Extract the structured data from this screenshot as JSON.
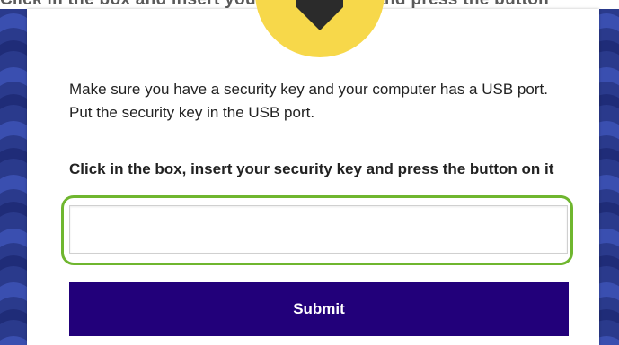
{
  "header": {
    "caption": "Click in the box and insert your security key and press the button"
  },
  "instructions": {
    "text": "Make sure you have a security key and your computer has a USB port. Put the security key in the USB port."
  },
  "security_key_field": {
    "label": "Click in the box, insert your security key and press the button on it",
    "value": "",
    "placeholder": ""
  },
  "submit": {
    "label": "Submit"
  },
  "colors": {
    "page_pattern_dark": "#1f2c78",
    "page_pattern_light": "#3a4fb0",
    "badge_yellow": "#f7d84a",
    "badge_icon": "#2b2b2b",
    "focus_ring": "#6fb62f",
    "submit_background": "#22007a",
    "submit_text": "#ffffff"
  },
  "icons": {
    "badge_icon": "shield-icon"
  }
}
